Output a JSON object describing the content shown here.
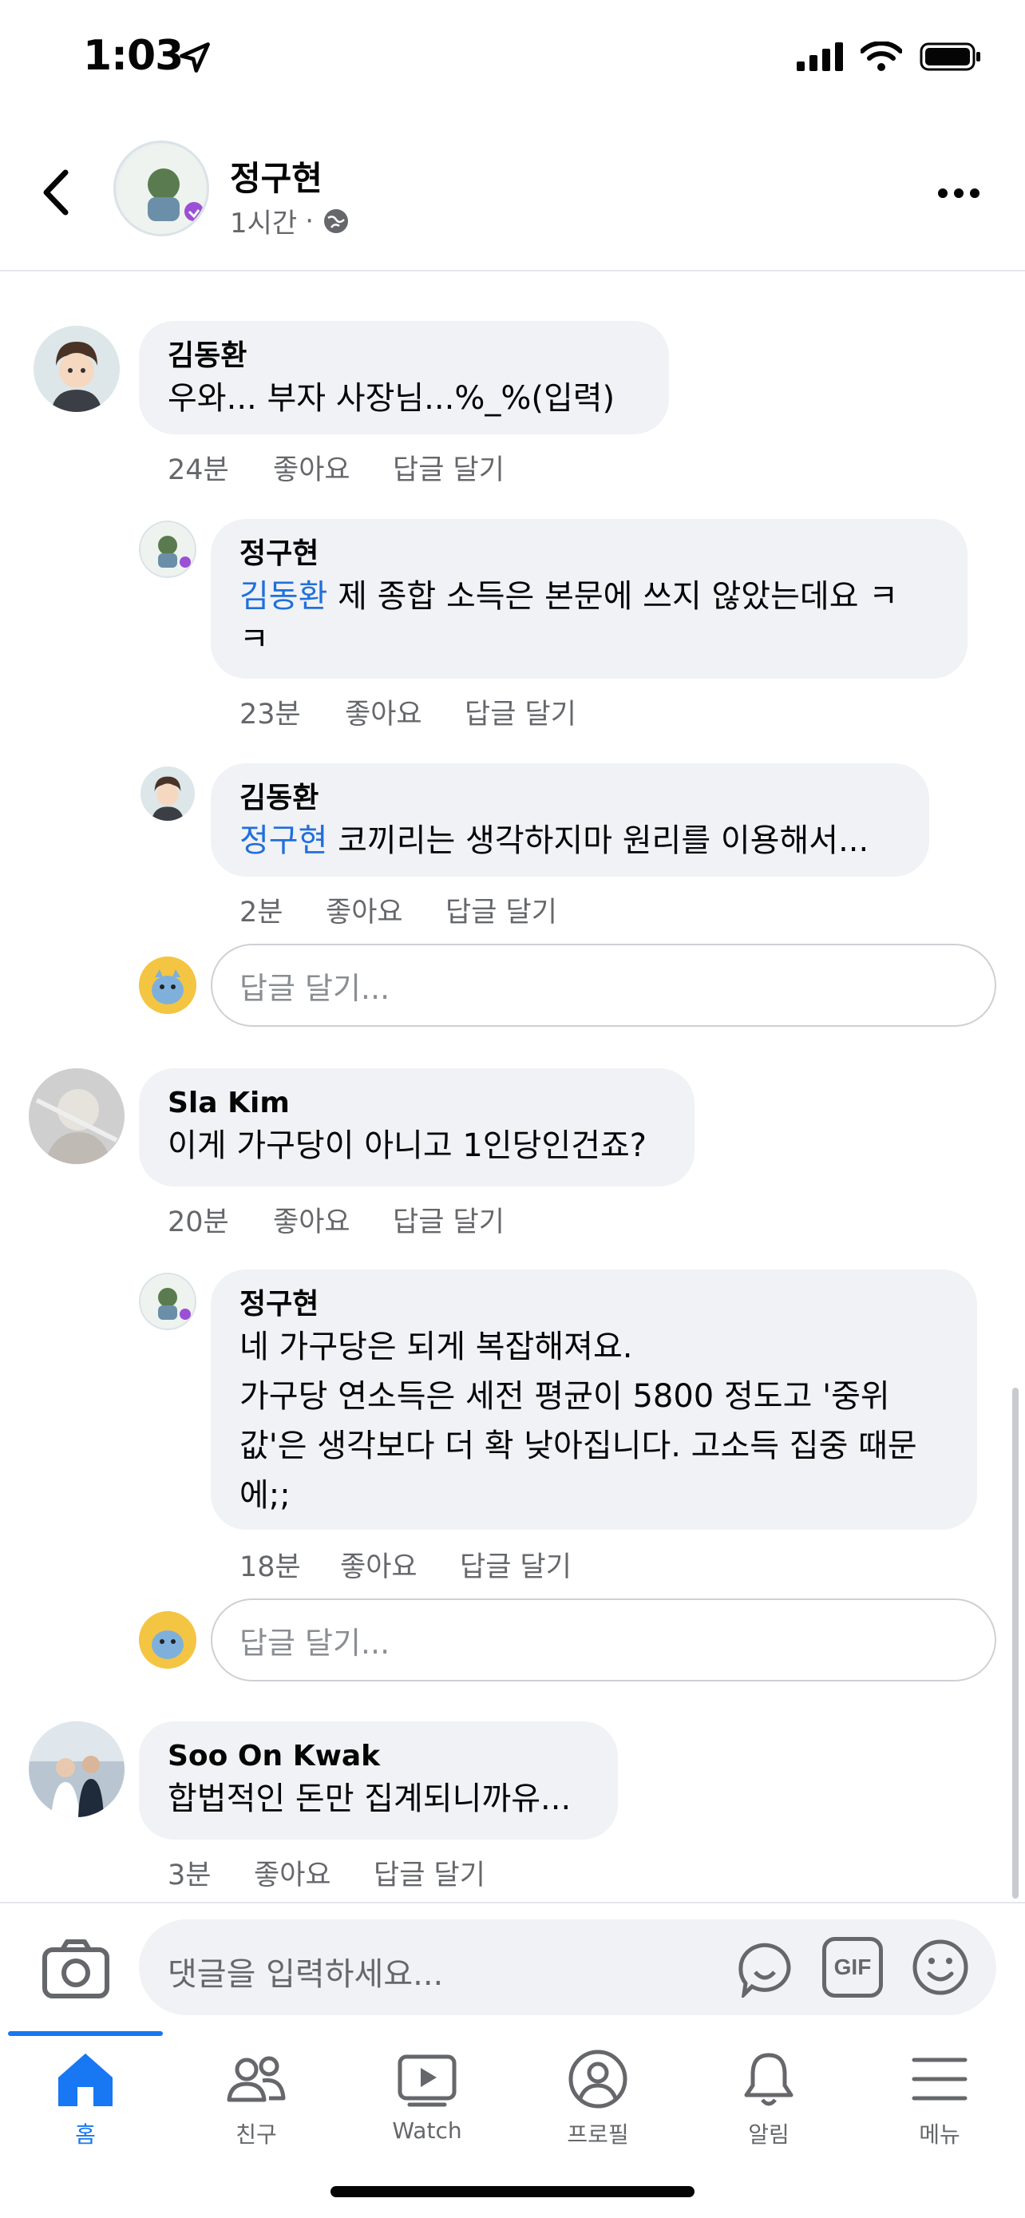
{
  "status_bar": {
    "time": "1:03"
  },
  "header": {
    "author": "정구현",
    "time_ago": "1시간",
    "separator": "·"
  },
  "comments": [
    {
      "name": "김동환",
      "text": "우와... 부자 사장님...%_%(입력)",
      "time": "24분",
      "like": "좋아요",
      "reply": "답글 달기",
      "replies": [
        {
          "name": "정구현",
          "mention": "김동환",
          "text_line1": " 제 종합 소득은 본문에 쓰지 않았는데요  ㅋ",
          "text_line2": "ㅋ",
          "time": "23분",
          "like": "좋아요",
          "reply": "답글 달기"
        },
        {
          "name": "김동환",
          "mention": "정구현",
          "text_line1": " 코끼리는 생각하지마 원리를 이용해서...",
          "time": "2분",
          "like": "좋아요",
          "reply": "답글 달기"
        }
      ],
      "reply_placeholder": "답글 달기..."
    },
    {
      "name": "Sla Kim",
      "text": "이게 가구당이 아니고 1인당인건죠?",
      "time": "20분",
      "like": "좋아요",
      "reply": "답글 달기",
      "replies": [
        {
          "name": "정구현",
          "lines": [
            "네 가구당은 되게 복잡해져요.",
            "가구당 연소득은 세전 평균이 5800 정도고 '중위",
            "값'은 생각보다 더 확 낮아집니다. 고소득 집중 때문",
            "에;;"
          ],
          "time": "18분",
          "like": "좋아요",
          "reply": "답글 달기"
        }
      ],
      "reply_placeholder": "답글 달기..."
    },
    {
      "name": "Soo On Kwak",
      "text": "합법적인 돈만 집계되니까유...",
      "time": "3분",
      "like": "좋아요",
      "reply": "답글 달기"
    }
  ],
  "composer": {
    "placeholder": "댓글을 입력하세요...",
    "gif_label": "GIF"
  },
  "tabs": [
    {
      "label": "홈",
      "icon": "home-icon",
      "active": true
    },
    {
      "label": "친구",
      "icon": "friends-icon",
      "active": false
    },
    {
      "label": "Watch",
      "icon": "watch-icon",
      "active": false
    },
    {
      "label": "프로필",
      "icon": "profile-icon",
      "active": false
    },
    {
      "label": "알림",
      "icon": "bell-icon",
      "active": false
    },
    {
      "label": "메뉴",
      "icon": "menu-icon",
      "active": false
    }
  ],
  "colors": {
    "accent": "#1877f2",
    "mention": "#216fdb",
    "bubble": "#f0f2f5",
    "secondary_text": "#65676b"
  }
}
